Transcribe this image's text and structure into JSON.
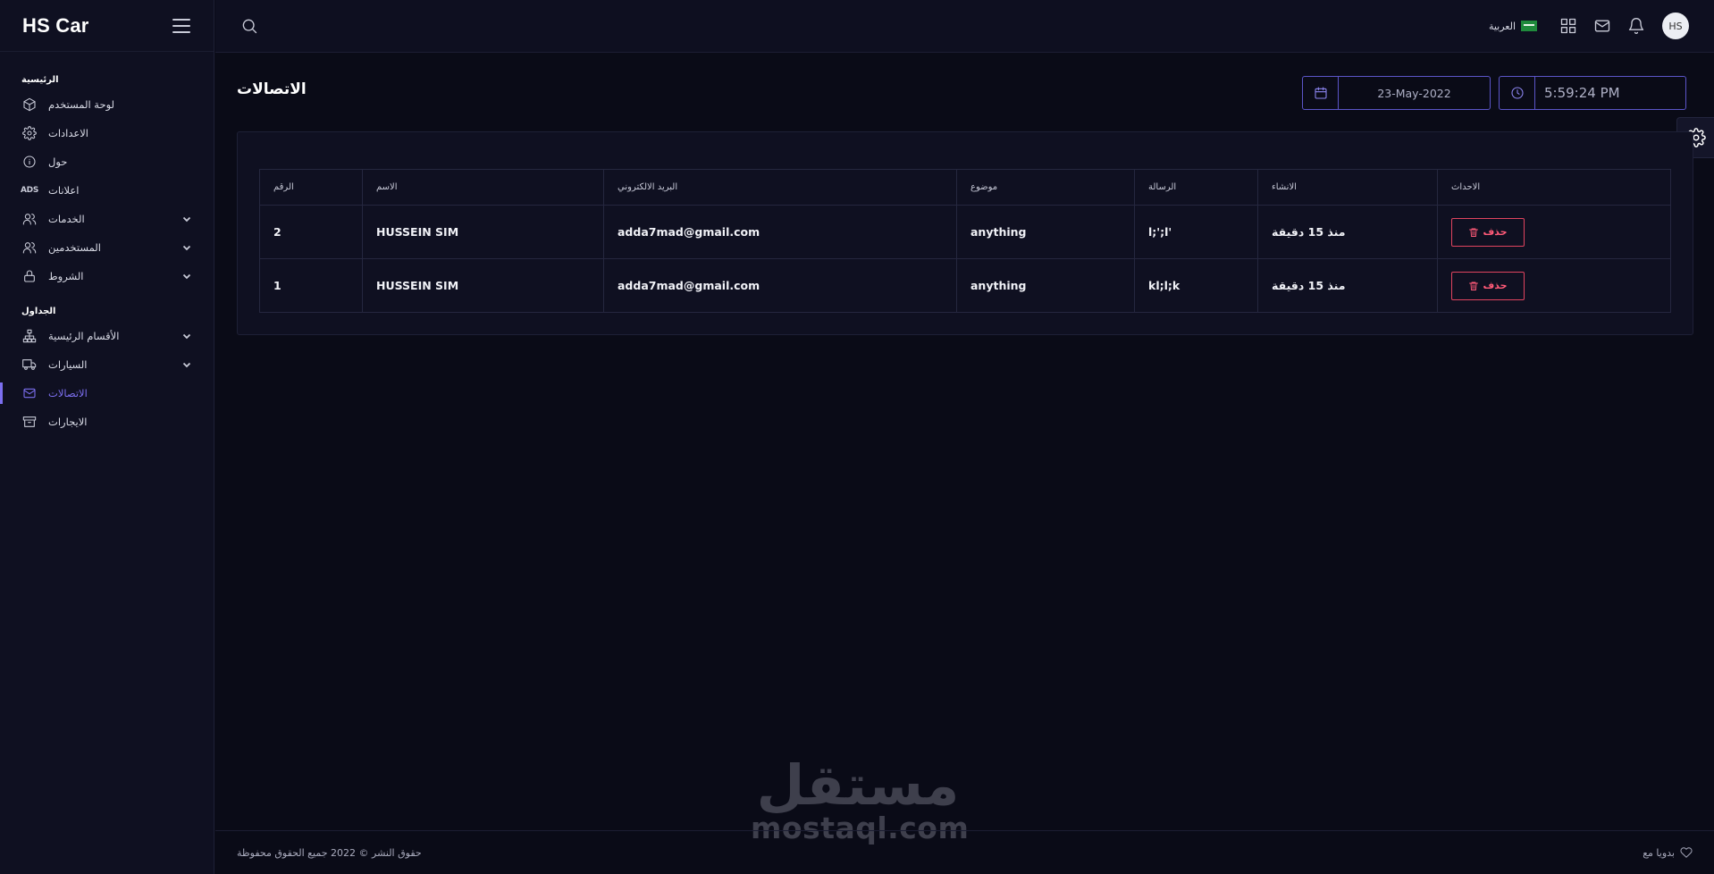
{
  "brand": {
    "title": "HS Car"
  },
  "sidebar": {
    "section_main": "الرئيسية",
    "section_tables": "الجداول",
    "items_main": [
      {
        "label": "لوحة المستخدم",
        "icon": "cube-icon"
      },
      {
        "label": "الاعدادات",
        "icon": "gear-icon"
      },
      {
        "label": "حول",
        "icon": "info-icon"
      },
      {
        "label": "اعلانات",
        "icon": "ads-icon",
        "icon_text": "ADS"
      },
      {
        "label": "الخدمات",
        "icon": "users-icon"
      },
      {
        "label": "المستخدمين",
        "icon": "users-icon"
      },
      {
        "label": "الشروط",
        "icon": "lock-icon"
      }
    ],
    "items_tables": [
      {
        "label": "الأقسام الرئيسية",
        "icon": "sitemap-icon"
      },
      {
        "label": "السيارات",
        "icon": "truck-icon"
      },
      {
        "label": "الاتصالات",
        "icon": "mail-icon"
      },
      {
        "label": "الايجارات",
        "icon": "archive-icon"
      }
    ]
  },
  "topbar": {
    "language_label": "العربية",
    "avatar_initials": "HS"
  },
  "page": {
    "title": "الاتصالات",
    "date_value": "23-May-2022",
    "time_value": "5:59:24 PM"
  },
  "table": {
    "headers": [
      "الرقم",
      "الاسم",
      "البريد الالكتروني",
      "موضوع",
      "الرسالة",
      "الانشاء",
      "الاحداث"
    ],
    "rows": [
      {
        "num": "2",
        "name": "HUSSEIN SIM",
        "email": "adda7mad@gmail.com",
        "subject": "anything",
        "message": "l;';l'",
        "created": "منذ 15 دقيقة",
        "action": "حذف"
      },
      {
        "num": "1",
        "name": "HUSSEIN SIM",
        "email": "adda7mad@gmail.com",
        "subject": "anything",
        "message": "kl;l;k",
        "created": "منذ 15 دقيقة",
        "action": "حذف"
      }
    ]
  },
  "watermark": {
    "arabic": "مستقل",
    "latin": "mostaql.com"
  },
  "footer": {
    "copyright": "حقوق النشر © 2022 جميع الحقوق محفوظة",
    "made_with": "بدويا مع"
  },
  "colors": {
    "accent": "#7c6ff0",
    "danger": "#e0445f",
    "background": "#0a0b17",
    "sidebar": "#0f1021"
  }
}
